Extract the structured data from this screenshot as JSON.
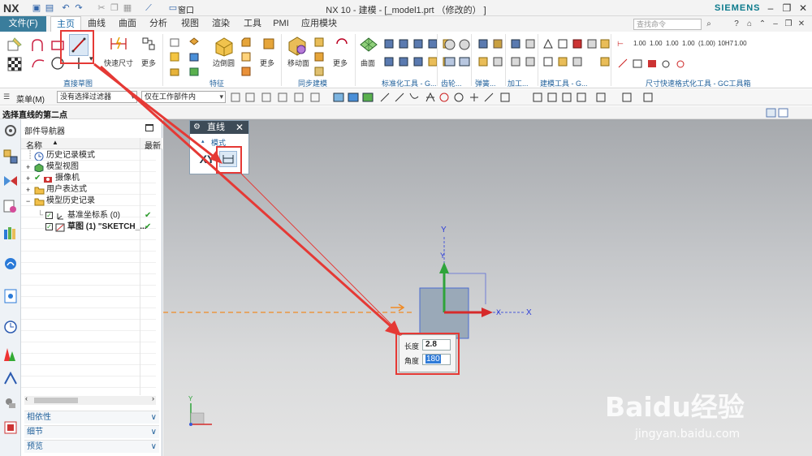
{
  "titlebar": {
    "app": "NX",
    "window_menu": "窗口",
    "document_title": "NX 10 - 建模 - [_model1.prt （修改的） ]",
    "brand": "SIEMENS"
  },
  "menubar": {
    "file": "文件(F)",
    "tabs": [
      "主页",
      "曲线",
      "曲面",
      "分析",
      "视图",
      "渲染",
      "工具",
      "PMI",
      "应用模块"
    ],
    "search_placeholder": "查找命令"
  },
  "ribbon": {
    "groups": [
      {
        "label": "直接草图"
      },
      {
        "label": "特征"
      },
      {
        "label": "同步建模"
      },
      {
        "label": "标准化工具 - G..."
      },
      {
        "label": "齿轮..."
      },
      {
        "label": "弹簧..."
      },
      {
        "label": "加工..."
      },
      {
        "label": "建模工具 - G..."
      },
      {
        "label": "尺寸快速格式化工具 - GC工具箱"
      }
    ],
    "labels": {
      "quick_dimension": "快速尺寸",
      "more": "更多",
      "edge_blend": "边倒圆",
      "move_face": "移动面",
      "surface": "曲面"
    },
    "dim_labels": [
      "1.00",
      "1.00",
      "1.00",
      "1.00",
      "(1.00)",
      "10H7",
      "1.00"
    ]
  },
  "toolbar2": {
    "menu_label": "菜单(M)",
    "filter": "没有选择过滤器",
    "scope": "仅在工作部件内"
  },
  "status": {
    "prompt": "选择直线的第二点"
  },
  "navigator": {
    "title": "部件导航器",
    "col_name": "名称",
    "col_latest": "最新",
    "items": [
      {
        "label": "历史记录模式"
      },
      {
        "label": "模型视图"
      },
      {
        "label": "摄像机"
      },
      {
        "label": "用户表达式"
      },
      {
        "label": "模型历史记录"
      },
      {
        "label": "基准坐标系 (0)"
      },
      {
        "label": "草图 (1) \"SKETCH_..."
      }
    ],
    "panels": [
      "相依性",
      "细节",
      "预览"
    ]
  },
  "line_dialog": {
    "title": "直线",
    "section": "模式",
    "xy": "XY"
  },
  "dynamic_input": {
    "length_label": "长度",
    "length_value": "2.8",
    "angle_label": "角度",
    "angle_value": "180"
  },
  "canvas": {
    "axis_y": "Y",
    "axis_x": "X"
  },
  "watermark": {
    "logo": "Baidu经验",
    "url": "jingyan.baidu.com"
  },
  "colors": {
    "annotation_red": "#e53935",
    "accent_blue": "#1f5f9a",
    "file_menu": "#3a7d9c"
  }
}
